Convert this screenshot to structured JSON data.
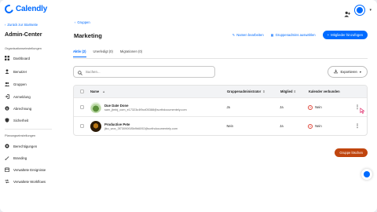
{
  "sidebar": {
    "logo_text": "Calendly",
    "back_link": "Zurück zur Startseite",
    "admin_title": "Admin-Center",
    "org_settings_label": "Organisationseinstellungen",
    "org_items": [
      {
        "label": "Dashboard",
        "icon": "grid-icon"
      },
      {
        "label": "Benutzer",
        "icon": "user-icon"
      },
      {
        "label": "Gruppen",
        "icon": "group-icon"
      },
      {
        "label": "Anmeldung",
        "icon": "signin-icon"
      },
      {
        "label": "Abrechnung",
        "icon": "billing-icon"
      },
      {
        "label": "Sicherheit",
        "icon": "shield-icon"
      }
    ],
    "planning_settings_label": "Planungseinstellungen",
    "planning_items": [
      {
        "label": "Berechtigungen",
        "icon": "permissions-icon"
      },
      {
        "label": "Branding",
        "icon": "branding-icon"
      },
      {
        "label": "Verwaltete Ereignisse",
        "icon": "events-icon"
      },
      {
        "label": "Verwaltete Workflows",
        "icon": "workflows-icon"
      }
    ]
  },
  "header": {
    "breadcrumb": "Gruppen",
    "title": "Marketing",
    "rename_label": "Namen bearbeiten",
    "admins_label": "Gruppenadmins auswählen",
    "add_members_label": "Mitglieder hinzufügen"
  },
  "tabs": [
    {
      "label": "Aktiv (2)",
      "active": true
    },
    {
      "label": "Unerledigt (0)",
      "active": false
    },
    {
      "label": "Migrationen (0)",
      "active": false
    }
  ],
  "search": {
    "placeholder": "Suchen..."
  },
  "export_label": "Exportieren",
  "table": {
    "headers": [
      "Name",
      "Gruppenadministrator",
      "Mitglied",
      "Kalender verbunden"
    ],
    "rows": [
      {
        "name": "Due Date Done",
        "email": "sam_jtmbj_com_e17323c4f9cd05388@scrthdocumentely.com",
        "group_admin": "Ja",
        "member": "Ja",
        "calendar": "Nein"
      },
      {
        "name": "Productive Pete",
        "email": "jiko_wox_3f73090f1f5b9b6092@scrthdocumentely.com",
        "group_admin": "Nein",
        "member": "Ja",
        "calendar": "Nein"
      }
    ]
  },
  "delete_group_label": "Gruppe löschen",
  "colors": {
    "accent": "#006bff",
    "danger": "#c0450e",
    "error_icon": "#e0473a"
  }
}
